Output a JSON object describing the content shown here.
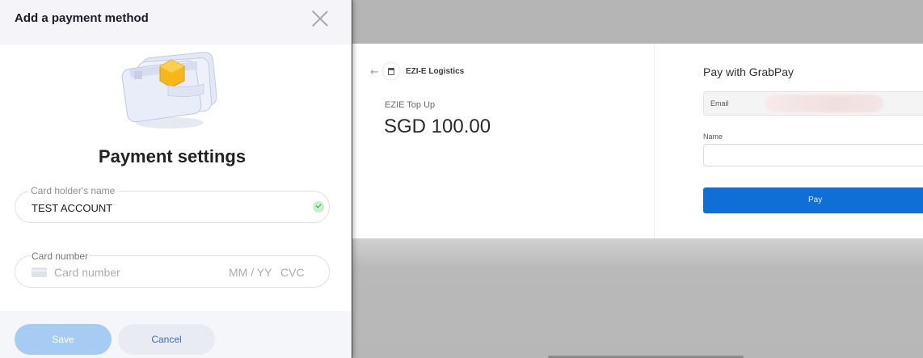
{
  "modal": {
    "title": "Add a payment method",
    "heading": "Payment settings",
    "card_holder": {
      "label": "Card holder's name",
      "value": "TEST ACCOUNT",
      "valid": true
    },
    "card_number": {
      "label": "Card number",
      "placeholder": "Card number",
      "expiry_placeholder": "MM / YY",
      "cvc_placeholder": "CVC"
    },
    "buttons": {
      "save": "Save",
      "cancel": "Cancel"
    }
  },
  "checkout": {
    "merchant": "EZI-E Logistics",
    "order_label": "EZIE Top Up",
    "amount": "SGD 100.00",
    "payment_title": "Pay with GrabPay",
    "email_label": "Email",
    "name_label": "Name",
    "pay_button": "Pay"
  },
  "colors": {
    "save_button": "#a6ccf3",
    "pay_button": "#0f6fd6",
    "valid_check": "#2e9a45"
  }
}
